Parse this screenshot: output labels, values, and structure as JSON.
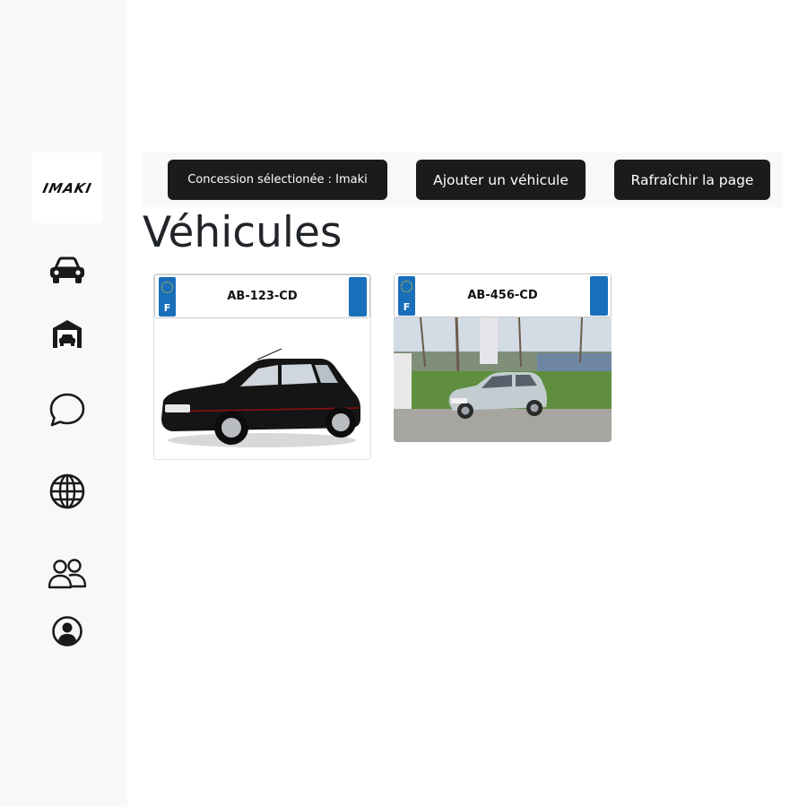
{
  "brand": {
    "logo_text": "IMAKI"
  },
  "sidebar": {
    "items": [
      {
        "name": "vehicles",
        "icon": "car-icon"
      },
      {
        "name": "garage",
        "icon": "garage-icon"
      },
      {
        "name": "messages",
        "icon": "chat-icon"
      },
      {
        "name": "web",
        "icon": "globe-icon"
      },
      {
        "name": "users",
        "icon": "people-icon"
      },
      {
        "name": "profile",
        "icon": "user-circle-icon"
      }
    ]
  },
  "toolbar": {
    "dealer_label": "Concession sélectionée : Imaki",
    "add_label": "Ajouter un véhicule",
    "refresh_label": "Rafraîchir la page"
  },
  "page": {
    "title": "Véhicules"
  },
  "vehicles": [
    {
      "plate": "AB-123-CD",
      "country": "F"
    },
    {
      "plate": "AB-456-CD",
      "country": "F"
    }
  ],
  "colors": {
    "plate_blue": "#1a6fbb",
    "button_dark": "#1b1b1b",
    "sidebar_bg": "#f7f8fa"
  }
}
